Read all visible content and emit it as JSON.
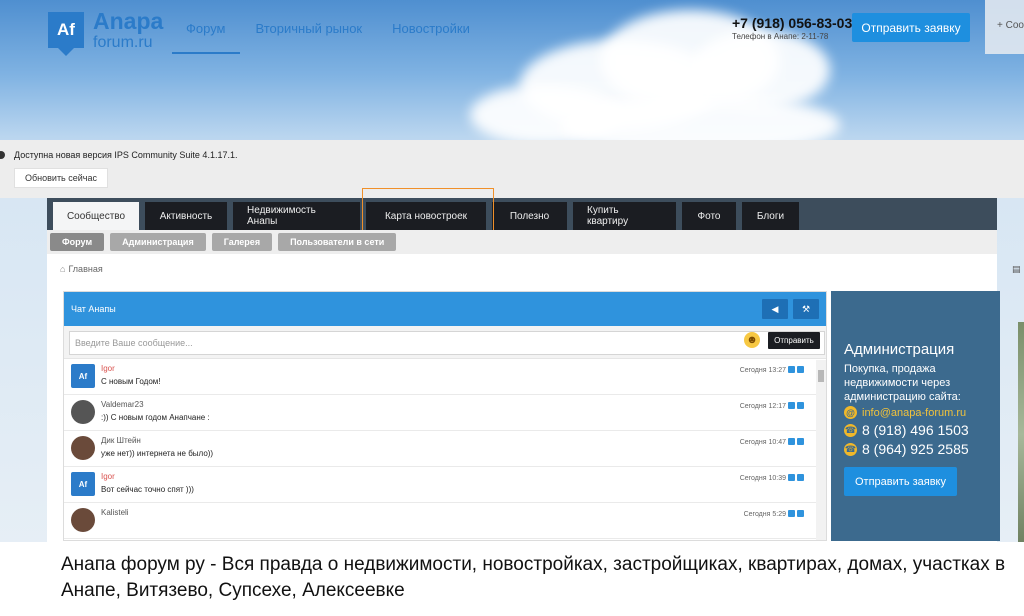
{
  "header": {
    "logo_mark": "Af",
    "logo_line1": "Anapa",
    "logo_line2": "forum.ru",
    "nav": [
      {
        "label": "Форум",
        "active": true
      },
      {
        "label": "Вторичный рынок",
        "active": false
      },
      {
        "label": "Новостройки",
        "active": false
      }
    ],
    "phone": "+7 (918) 056-83-03",
    "phone_note": "Телефон в Анапе: 2-11-78",
    "apply_label": "Отправить заявку",
    "side_label": "+ Соо"
  },
  "update_bar": {
    "text": "Доступна новая версия IPS Community Suite 4.1.17.1.",
    "button": "Обновить сейчас"
  },
  "tabs": [
    {
      "label": "Сообщество",
      "active": true
    },
    {
      "label": "Активность",
      "active": false
    },
    {
      "label": "Недвижимость Анапы",
      "active": false
    },
    {
      "label": "Карта новостроек",
      "active": false
    },
    {
      "label": "Полезно",
      "active": false
    },
    {
      "label": "Купить квартиру",
      "active": false
    },
    {
      "label": "Фото",
      "active": false
    },
    {
      "label": "Блоги",
      "active": false
    }
  ],
  "subtabs": [
    {
      "label": "Форум",
      "active": true
    },
    {
      "label": "Администрация",
      "active": false
    },
    {
      "label": "Галерея",
      "active": false
    },
    {
      "label": "Пользователи в сети",
      "active": false
    }
  ],
  "breadcrumb": {
    "home": "Главная"
  },
  "chat": {
    "title": "Чат Анапы",
    "placeholder": "Введите Ваше сообщение...",
    "send_label": "Отправить",
    "messages": [
      {
        "user": "Igor",
        "text": "С новым Годом!",
        "time": "Сегодня 13:27",
        "user_color": "#d9534f",
        "avatar": "logo"
      },
      {
        "user": "Valdemar23",
        "text": ":)) С новым годом Анапчане :",
        "time": "Сегодня 12:17",
        "user_color": "#555555",
        "avatar": "gray"
      },
      {
        "user": "Дик Штейн",
        "text": "уже нет)) интернета не было))",
        "time": "Сегодня 10:47",
        "user_color": "#555555",
        "avatar": "dark"
      },
      {
        "user": "Igor",
        "text": "Вот сейчас точно спят )))",
        "time": "Сегодня 10:39",
        "user_color": "#d9534f",
        "avatar": "logo"
      },
      {
        "user": "Kalisteli",
        "text": "",
        "time": "Сегодня 5:29",
        "user_color": "#555555",
        "avatar": "dark"
      }
    ]
  },
  "admin": {
    "title": "Администрация",
    "desc": "Покупка, продажа недвижимости через администрацию сайта:",
    "email": "info@anapa-forum.ru",
    "phone1": "8 (918) 496 1503",
    "phone2": "8 (964) 925 2585",
    "apply_label": "Отправить заявку"
  },
  "caption": "Анапа форум ру - Вся правда о недвижимости, новостройках, застройщиках, квартирах, домах, участках в Анапе, Витязево, Супсехе, Алексеевке",
  "colors": {
    "accent": "#2b7bc9",
    "tab_bar": "#3d4d5c",
    "admin_bg": "#3c6a8e",
    "highlight": "#f0902a"
  }
}
